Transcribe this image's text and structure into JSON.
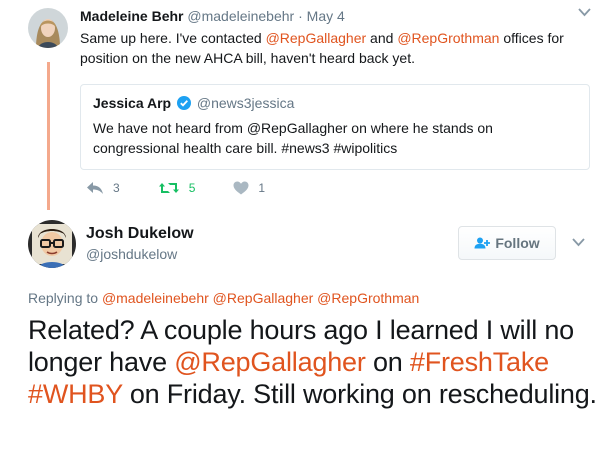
{
  "parent_tweet": {
    "name": "Madeleine Behr",
    "handle": "@madeleinebehr",
    "separator": "·",
    "date": "May 4",
    "text_parts": [
      {
        "text": "Same up here. I've contacted ",
        "type": "text"
      },
      {
        "text": "@RepGallagher",
        "type": "mention"
      },
      {
        "text": " and ",
        "type": "text"
      },
      {
        "text": "@RepGrothman",
        "type": "mention"
      },
      {
        "text": " offices for position on the new AHCA bill, haven't heard back yet.",
        "type": "text"
      }
    ],
    "quoted": {
      "name": "Jessica Arp",
      "handle": "@news3jessica",
      "text": "We have not heard from @RepGallagher on where he stands on congressional health care bill. #news3 #wipolitics"
    },
    "actions": {
      "reply_count": "3",
      "retweet_count": "5",
      "like_count": "1"
    }
  },
  "main_tweet": {
    "name": "Josh Dukelow",
    "handle": "@joshdukelow",
    "follow_label": "Follow",
    "replying_label": "Replying to",
    "replying_to": [
      "@madeleinebehr",
      "@RepGallagher",
      "@RepGrothman"
    ],
    "text_parts": [
      {
        "text": "Related? A couple hours ago I learned I will no longer have ",
        "type": "text"
      },
      {
        "text": "@RepGallagher",
        "type": "mention"
      },
      {
        "text": " on ",
        "type": "text"
      },
      {
        "text": "#FreshTake",
        "type": "mention"
      },
      {
        "text": " ",
        "type": "text"
      },
      {
        "text": "#WHBY",
        "type": "mention"
      },
      {
        "text": " on Friday. Still working on rescheduling.",
        "type": "text"
      }
    ]
  },
  "icons": {
    "reply": "reply-icon",
    "retweet": "retweet-icon",
    "like": "heart-icon",
    "caret": "chevron-down-icon",
    "verified": "verified-badge-icon",
    "follow": "add-user-icon"
  },
  "colors": {
    "accent": "#e0541f",
    "retweet": "#17bf63",
    "secondary_text": "#657786",
    "thread_line": "#f4a98c",
    "verified": "#1da1f2"
  }
}
